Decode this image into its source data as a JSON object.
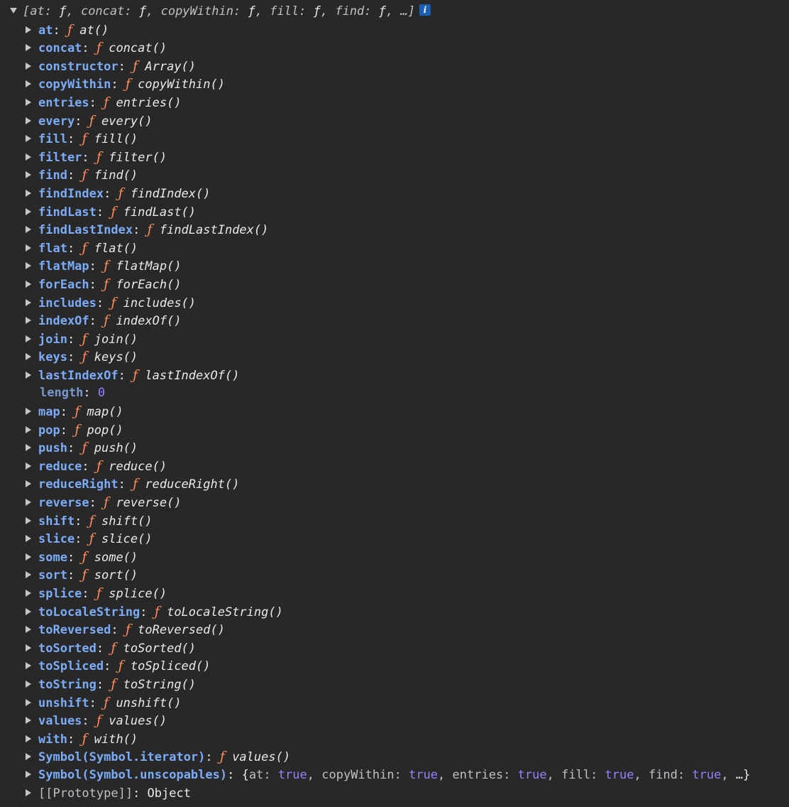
{
  "header": {
    "preview_open": "[",
    "preview_items": [
      {
        "key": "at",
        "value": "ƒ"
      },
      {
        "key": "concat",
        "value": "ƒ"
      },
      {
        "key": "copyWithin",
        "value": "ƒ"
      },
      {
        "key": "fill",
        "value": "ƒ"
      },
      {
        "key": "find",
        "value": "ƒ"
      }
    ],
    "preview_tail": "…]",
    "info_label": "i"
  },
  "properties": [
    {
      "key": "at",
      "fn": "at()"
    },
    {
      "key": "concat",
      "fn": "concat()"
    },
    {
      "key": "constructor",
      "fn": "Array()"
    },
    {
      "key": "copyWithin",
      "fn": "copyWithin()"
    },
    {
      "key": "entries",
      "fn": "entries()"
    },
    {
      "key": "every",
      "fn": "every()"
    },
    {
      "key": "fill",
      "fn": "fill()"
    },
    {
      "key": "filter",
      "fn": "filter()"
    },
    {
      "key": "find",
      "fn": "find()"
    },
    {
      "key": "findIndex",
      "fn": "findIndex()"
    },
    {
      "key": "findLast",
      "fn": "findLast()"
    },
    {
      "key": "findLastIndex",
      "fn": "findLastIndex()"
    },
    {
      "key": "flat",
      "fn": "flat()"
    },
    {
      "key": "flatMap",
      "fn": "flatMap()"
    },
    {
      "key": "forEach",
      "fn": "forEach()"
    },
    {
      "key": "includes",
      "fn": "includes()"
    },
    {
      "key": "indexOf",
      "fn": "indexOf()"
    },
    {
      "key": "join",
      "fn": "join()"
    },
    {
      "key": "keys",
      "fn": "keys()"
    },
    {
      "key": "lastIndexOf",
      "fn": "lastIndexOf()"
    }
  ],
  "length_row": {
    "key": "length",
    "value": "0"
  },
  "properties2": [
    {
      "key": "map",
      "fn": "map()"
    },
    {
      "key": "pop",
      "fn": "pop()"
    },
    {
      "key": "push",
      "fn": "push()"
    },
    {
      "key": "reduce",
      "fn": "reduce()"
    },
    {
      "key": "reduceRight",
      "fn": "reduceRight()"
    },
    {
      "key": "reverse",
      "fn": "reverse()"
    },
    {
      "key": "shift",
      "fn": "shift()"
    },
    {
      "key": "slice",
      "fn": "slice()"
    },
    {
      "key": "some",
      "fn": "some()"
    },
    {
      "key": "sort",
      "fn": "sort()"
    },
    {
      "key": "splice",
      "fn": "splice()"
    },
    {
      "key": "toLocaleString",
      "fn": "toLocaleString()"
    },
    {
      "key": "toReversed",
      "fn": "toReversed()"
    },
    {
      "key": "toSorted",
      "fn": "toSorted()"
    },
    {
      "key": "toSpliced",
      "fn": "toSpliced()"
    },
    {
      "key": "toString",
      "fn": "toString()"
    },
    {
      "key": "unshift",
      "fn": "unshift()"
    },
    {
      "key": "values",
      "fn": "values()"
    },
    {
      "key": "with",
      "fn": "with()"
    },
    {
      "key": "Symbol(Symbol.iterator)",
      "fn": "values()"
    }
  ],
  "unscopables": {
    "key": "Symbol(Symbol.unscopables)",
    "open": "{",
    "items": [
      {
        "key": "at",
        "value": "true"
      },
      {
        "key": "copyWithin",
        "value": "true"
      },
      {
        "key": "entries",
        "value": "true"
      },
      {
        "key": "fill",
        "value": "true"
      },
      {
        "key": "find",
        "value": "true"
      }
    ],
    "tail": "…}"
  },
  "prototype": {
    "key": "[[Prototype]]",
    "value": "Object"
  },
  "f_glyph": "ƒ",
  "colors": {
    "background": "#282828",
    "key": "#7cacf8",
    "function_f": "#ff8b5a",
    "number": "#9980ff",
    "text": "#e8eaed"
  }
}
